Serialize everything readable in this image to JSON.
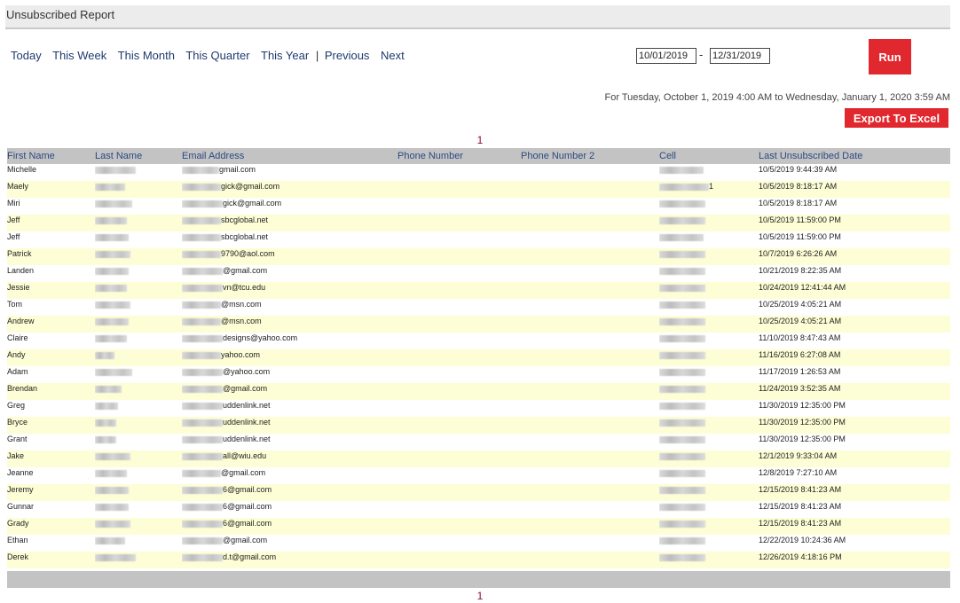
{
  "page": {
    "title": "Unsubscribed Report"
  },
  "nav": {
    "today": "Today",
    "this_week": "This Week",
    "this_month": "This Month",
    "this_quarter": "This Quarter",
    "this_year": "This Year",
    "separator": "|",
    "previous": "Previous",
    "next": "Next"
  },
  "date_range": {
    "start": "10/01/2019",
    "dash": "-",
    "end": "12/31/2019"
  },
  "run_label": "Run",
  "range_text": "For Tuesday, October 1, 2019 4:00 AM to Wednesday, January 1, 2020 3:59 AM",
  "export_label": "Export To Excel",
  "pager": {
    "top": "1",
    "bottom": "1"
  },
  "colors": {
    "accent_red": "#e0282e",
    "header_gray": "#c3c3c3",
    "row_alt": "#fdfdd6",
    "link_blue": "#1f3a6e",
    "pager_red": "#8b0d2a"
  },
  "table": {
    "columns": [
      "First Name",
      "Last Name",
      "Email Address",
      "Phone Number",
      "Phone Number 2",
      "Cell",
      "Last Unsubscribed Date"
    ],
    "rows": [
      {
        "first": "Michelle",
        "email_suffix": "gmail.com",
        "cell_suffix": "",
        "date": "10/5/2019 9:44:39 AM"
      },
      {
        "first": "Maely",
        "email_suffix": "gick@gmail.com",
        "cell_suffix": "1",
        "date": "10/5/2019 8:18:17 AM"
      },
      {
        "first": "Miri",
        "email_suffix": "gick@gmail.com",
        "cell_suffix": "",
        "date": "10/5/2019 8:18:17 AM"
      },
      {
        "first": "Jeff",
        "email_suffix": "sbcglobal.net",
        "cell_suffix": "",
        "date": "10/5/2019 11:59:00 PM"
      },
      {
        "first": "Jeff",
        "email_suffix": "sbcglobal.net",
        "cell_suffix": "",
        "date": "10/5/2019 11:59:00 PM"
      },
      {
        "first": "Patrick",
        "email_suffix": "9790@aol.com",
        "cell_suffix": "",
        "date": "10/7/2019 6:26:26 AM"
      },
      {
        "first": "Landen",
        "email_suffix": "@gmail.com",
        "cell_suffix": "",
        "date": "10/21/2019 8:22:35 AM"
      },
      {
        "first": "Jessie",
        "email_suffix": "vn@tcu.edu",
        "cell_suffix": "",
        "date": "10/24/2019 12:41:44 AM"
      },
      {
        "first": "Tom",
        "email_suffix": "@msn.com",
        "cell_suffix": "",
        "date": "10/25/2019 4:05:21 AM"
      },
      {
        "first": "Andrew",
        "email_suffix": "@msn.com",
        "cell_suffix": "",
        "date": "10/25/2019 4:05:21 AM"
      },
      {
        "first": "Claire",
        "email_suffix": "designs@yahoo.com",
        "cell_suffix": "",
        "date": "11/10/2019 8:47:43 AM"
      },
      {
        "first": "Andy",
        "email_suffix": "yahoo.com",
        "cell_suffix": "",
        "date": "11/16/2019 6:27:08 AM"
      },
      {
        "first": "Adam",
        "email_suffix": "@yahoo.com",
        "cell_suffix": "",
        "date": "11/17/2019 1:26:53 AM"
      },
      {
        "first": "Brendan",
        "email_suffix": "@gmail.com",
        "cell_suffix": "",
        "date": "11/24/2019 3:52:35 AM"
      },
      {
        "first": "Greg",
        "email_suffix": "uddenlink.net",
        "cell_suffix": "",
        "date": "11/30/2019 12:35:00 PM"
      },
      {
        "first": "Bryce",
        "email_suffix": "uddenlink.net",
        "cell_suffix": "",
        "date": "11/30/2019 12:35:00 PM"
      },
      {
        "first": "Grant",
        "email_suffix": "uddenlink.net",
        "cell_suffix": "",
        "date": "11/30/2019 12:35:00 PM"
      },
      {
        "first": "Jake",
        "email_suffix": "all@wiu.edu",
        "cell_suffix": "",
        "date": "12/1/2019 9:33:04 AM"
      },
      {
        "first": "Jeanne",
        "email_suffix": "@gmail.com",
        "cell_suffix": "",
        "date": "12/8/2019 7:27:10 AM"
      },
      {
        "first": "Jeremy",
        "email_suffix": "6@gmail.com",
        "cell_suffix": "",
        "date": "12/15/2019 8:41:23 AM"
      },
      {
        "first": "Gunnar",
        "email_suffix": "6@gmail.com",
        "cell_suffix": "",
        "date": "12/15/2019 8:41:23 AM"
      },
      {
        "first": "Grady",
        "email_suffix": "6@gmail.com",
        "cell_suffix": "",
        "date": "12/15/2019 8:41:23 AM"
      },
      {
        "first": "Ethan",
        "email_suffix": "@gmail.com",
        "cell_suffix": "",
        "date": "12/22/2019 10:24:36 AM"
      },
      {
        "first": "Derek",
        "email_suffix": "d.t@gmail.com",
        "cell_suffix": "",
        "date": "12/26/2019 4:18:16 PM"
      }
    ]
  }
}
